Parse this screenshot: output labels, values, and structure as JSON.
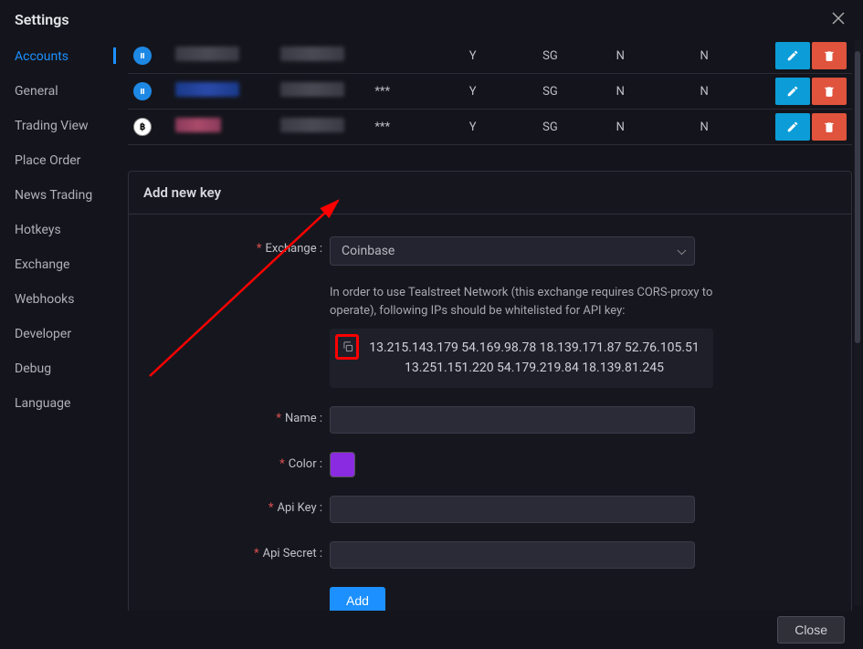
{
  "modal": {
    "title": "Settings",
    "close_label": "Close"
  },
  "sidebar": {
    "items": [
      {
        "label": "Accounts",
        "active": true
      },
      {
        "label": "General"
      },
      {
        "label": "Trading View"
      },
      {
        "label": "Place Order"
      },
      {
        "label": "News Trading"
      },
      {
        "label": "Hotkeys"
      },
      {
        "label": "Exchange"
      },
      {
        "label": "Webhooks"
      },
      {
        "label": "Developer"
      },
      {
        "label": "Debug"
      },
      {
        "label": "Language"
      }
    ]
  },
  "keys_table": {
    "rows": [
      {
        "exchange_icon": "blue",
        "icon_text": "",
        "masked": "",
        "c3": "Y",
        "c4": "SG",
        "c5": "N",
        "c6": "N"
      },
      {
        "exchange_icon": "blue",
        "icon_text": "",
        "masked": "***",
        "c3": "Y",
        "c4": "SG",
        "c5": "N",
        "c6": "N"
      },
      {
        "exchange_icon": "orange",
        "icon_text": "฿",
        "masked": "***",
        "c3": "Y",
        "c4": "SG",
        "c5": "N",
        "c6": "N"
      }
    ]
  },
  "add_key": {
    "panel_title": "Add new key",
    "exchange_label": "Exchange :",
    "exchange_value": "Coinbase",
    "info_text": "In order to use Tealstreet Network (this exchange requires CORS-proxy to operate), following IPs should be whitelisted for API key:",
    "ips_line1": "13.215.143.179  54.169.98.78  18.139.171.87  52.76.105.51",
    "ips_line2": "13.251.151.220  54.179.219.84  18.139.81.245",
    "name_label": "Name :",
    "name_value": "",
    "color_label": "Color :",
    "color_value": "#8a2be2",
    "api_key_label": "Api Key :",
    "api_key_value": "",
    "api_secret_label": "Api Secret :",
    "api_secret_value": "",
    "add_button": "Add"
  }
}
